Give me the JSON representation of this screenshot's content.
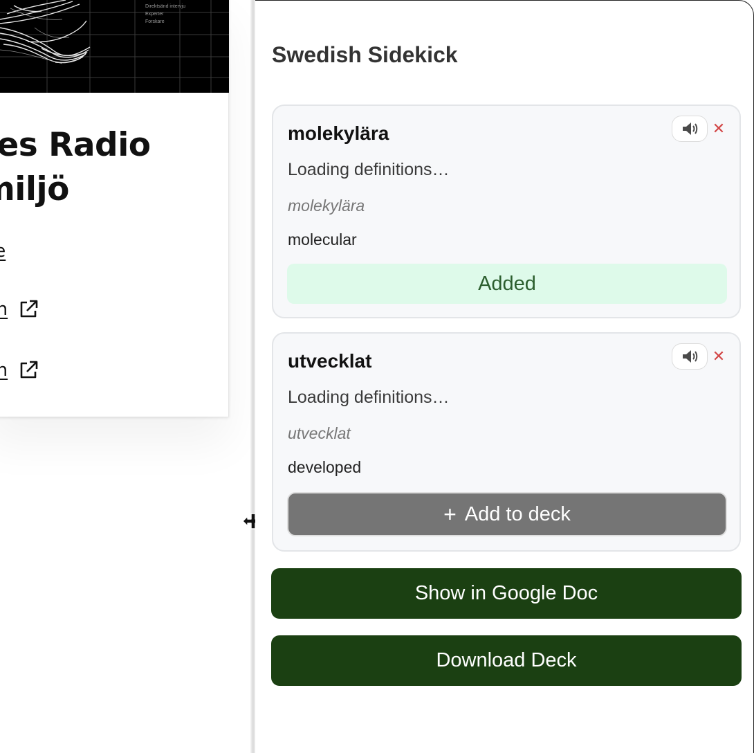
{
  "background_page": {
    "hero_legend": [
      "Direktsänd intervju",
      "Experter",
      "Forskare"
    ],
    "headline_lines": [
      "riges Radio",
      "h miljö"
    ],
    "links": [
      {
        "text": "o.se",
        "external": false
      },
      {
        "text": "dion",
        "external": true,
        "icon": "external-link-icon"
      },
      {
        "text": "dion",
        "external": true,
        "icon": "external-link-icon"
      }
    ]
  },
  "panel": {
    "title": "Swedish Sidekick",
    "cards": [
      {
        "word": "molekylära",
        "status": "Loading definitions…",
        "lemma": "molekylära",
        "translation": "molecular",
        "audio_icon": "speaker-icon",
        "remove_symbol": "✕",
        "deck_state": "added",
        "added_label": "Added"
      },
      {
        "word": "utvecklat",
        "status": "Loading definitions…",
        "lemma": "utvecklat",
        "translation": "developed",
        "audio_icon": "speaker-icon",
        "remove_symbol": "✕",
        "deck_state": "not_added",
        "add_symbol": "+",
        "add_label": "Add to deck"
      }
    ],
    "show_google_doc_label": "Show in Google Doc",
    "download_deck_label": "Download Deck"
  },
  "colors": {
    "primary_button": "#1b4012",
    "added_badge_bg": "#defaea",
    "added_badge_text": "#2c5e2e",
    "add_button_bg": "#757575",
    "remove_icon": "#d24545",
    "card_bg": "#f7f8fa"
  }
}
